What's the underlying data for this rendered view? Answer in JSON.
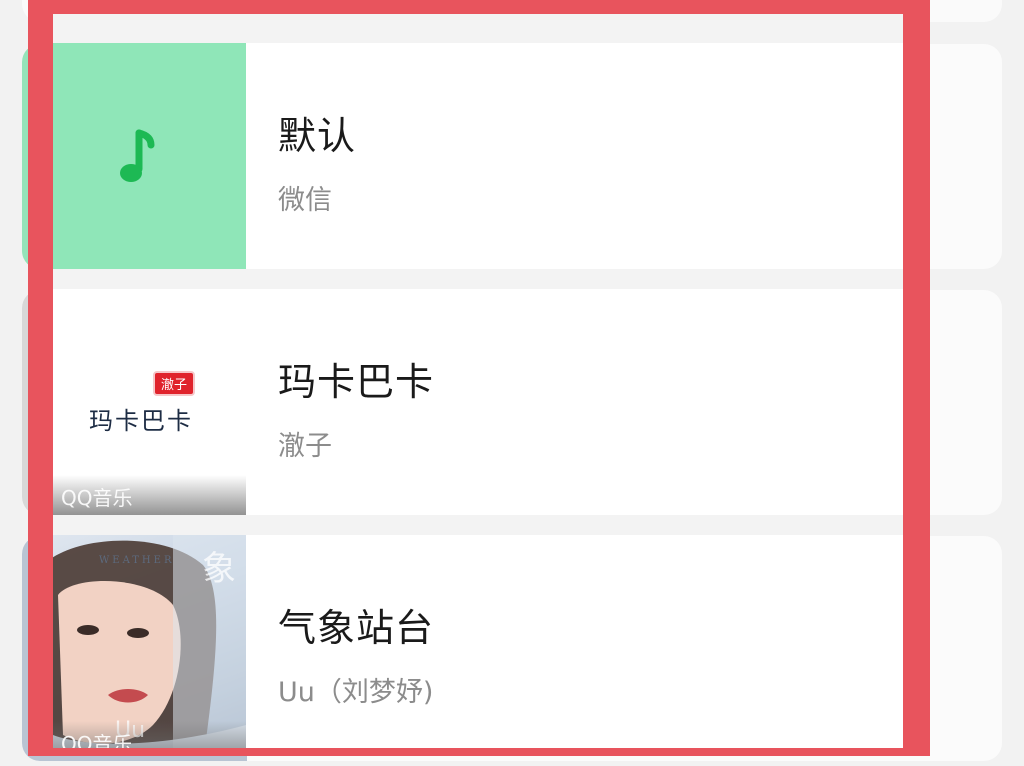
{
  "songs": [
    {
      "title": "默认",
      "artist": "微信",
      "cover": "music-note-icon"
    },
    {
      "title": "玛卡巴卡",
      "artist": "澈子",
      "cover_text": "玛卡巴卡",
      "cover_tag": "澈子",
      "source": "QQ音乐"
    },
    {
      "title": "气象站台",
      "artist": "Uu（刘梦妤)",
      "cover_word": "WEATHER",
      "cover_char": "象",
      "cover_signature": "Uu",
      "source": "QQ音乐"
    }
  ],
  "colors": {
    "selection_frame": "#e8545d",
    "default_cover": "#8fe6b8",
    "note": "#1db954"
  }
}
